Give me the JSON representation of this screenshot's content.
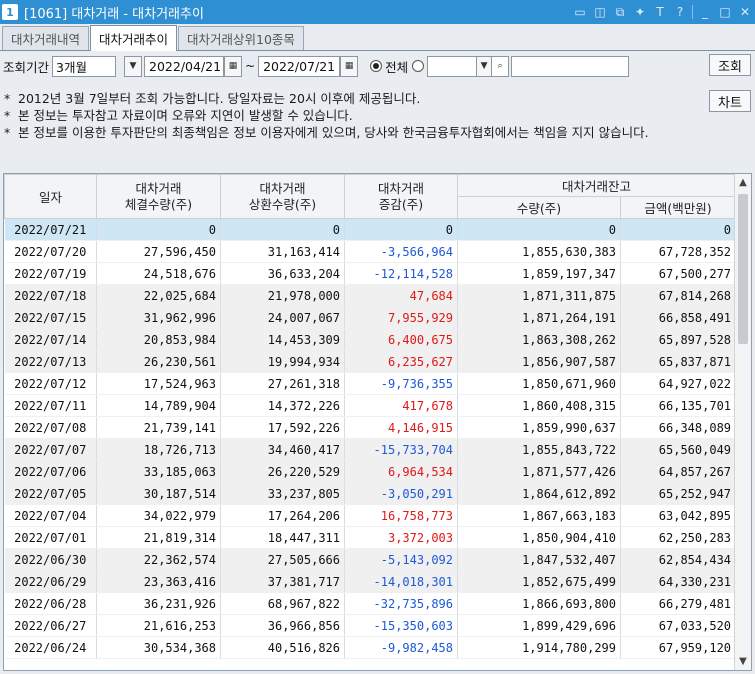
{
  "window": {
    "number": "1",
    "title": "[1061] 대차거래 - 대차거래추이"
  },
  "tabs": [
    {
      "label": "대차거래내역"
    },
    {
      "label": "대차거래추이"
    },
    {
      "label": "대차거래상위10종목"
    }
  ],
  "filter": {
    "period_label": "조회기간",
    "period_value": "3개월",
    "start_date": "2022/04/21",
    "end_date": "2022/07/21",
    "range_sep": "~",
    "radio_all_label": "전체",
    "search_button": "조회",
    "chart_button": "차트"
  },
  "notes": [
    "2012년 3월 7일부터 조회 가능합니다. 당일자료는 20시 이후에 제공됩니다.",
    "본 정보는 투자참고 자료이며 오류와 지연이 발생할 수 있습니다.",
    "본 정보를 이용한 투자판단의 최종책임은 정보 이용자에게 있으며, 당사와 한국금융투자협회에서는 책임을 지지 않습니다."
  ],
  "table": {
    "headers": {
      "date": "일자",
      "executed": "대차거래\n체결수량(주)",
      "repaid": "대차거래\n상환수량(주)",
      "change": "대차거래\n증감(주)",
      "balance_group": "대차거래잔고",
      "balance_qty": "수량(주)",
      "balance_amt": "금액(백만원)"
    },
    "rows": [
      {
        "date": "2022/07/21",
        "executed": "0",
        "repaid": "0",
        "change": "0",
        "qty": "0",
        "amt": "0"
      },
      {
        "date": "2022/07/20",
        "executed": "27,596,450",
        "repaid": "31,163,414",
        "change": "-3,566,964",
        "qty": "1,855,630,383",
        "amt": "67,728,352"
      },
      {
        "date": "2022/07/19",
        "executed": "24,518,676",
        "repaid": "36,633,204",
        "change": "-12,114,528",
        "qty": "1,859,197,347",
        "amt": "67,500,277"
      },
      {
        "date": "2022/07/18",
        "executed": "22,025,684",
        "repaid": "21,978,000",
        "change": "47,684",
        "qty": "1,871,311,875",
        "amt": "67,814,268"
      },
      {
        "date": "2022/07/15",
        "executed": "31,962,996",
        "repaid": "24,007,067",
        "change": "7,955,929",
        "qty": "1,871,264,191",
        "amt": "66,858,491"
      },
      {
        "date": "2022/07/14",
        "executed": "20,853,984",
        "repaid": "14,453,309",
        "change": "6,400,675",
        "qty": "1,863,308,262",
        "amt": "65,897,528"
      },
      {
        "date": "2022/07/13",
        "executed": "26,230,561",
        "repaid": "19,994,934",
        "change": "6,235,627",
        "qty": "1,856,907,587",
        "amt": "65,837,871"
      },
      {
        "date": "2022/07/12",
        "executed": "17,524,963",
        "repaid": "27,261,318",
        "change": "-9,736,355",
        "qty": "1,850,671,960",
        "amt": "64,927,022"
      },
      {
        "date": "2022/07/11",
        "executed": "14,789,904",
        "repaid": "14,372,226",
        "change": "417,678",
        "qty": "1,860,408,315",
        "amt": "66,135,701"
      },
      {
        "date": "2022/07/08",
        "executed": "21,739,141",
        "repaid": "17,592,226",
        "change": "4,146,915",
        "qty": "1,859,990,637",
        "amt": "66,348,089"
      },
      {
        "date": "2022/07/07",
        "executed": "18,726,713",
        "repaid": "34,460,417",
        "change": "-15,733,704",
        "qty": "1,855,843,722",
        "amt": "65,560,049"
      },
      {
        "date": "2022/07/06",
        "executed": "33,185,063",
        "repaid": "26,220,529",
        "change": "6,964,534",
        "qty": "1,871,577,426",
        "amt": "64,857,267"
      },
      {
        "date": "2022/07/05",
        "executed": "30,187,514",
        "repaid": "33,237,805",
        "change": "-3,050,291",
        "qty": "1,864,612,892",
        "amt": "65,252,947"
      },
      {
        "date": "2022/07/04",
        "executed": "34,022,979",
        "repaid": "17,264,206",
        "change": "16,758,773",
        "qty": "1,867,663,183",
        "amt": "63,042,895"
      },
      {
        "date": "2022/07/01",
        "executed": "21,819,314",
        "repaid": "18,447,311",
        "change": "3,372,003",
        "qty": "1,850,904,410",
        "amt": "62,250,283"
      },
      {
        "date": "2022/06/30",
        "executed": "22,362,574",
        "repaid": "27,505,666",
        "change": "-5,143,092",
        "qty": "1,847,532,407",
        "amt": "62,854,434"
      },
      {
        "date": "2022/06/29",
        "executed": "23,363,416",
        "repaid": "37,381,717",
        "change": "-14,018,301",
        "qty": "1,852,675,499",
        "amt": "64,330,231"
      },
      {
        "date": "2022/06/28",
        "executed": "36,231,926",
        "repaid": "68,967,822",
        "change": "-32,735,896",
        "qty": "1,866,693,800",
        "amt": "66,279,481"
      },
      {
        "date": "2022/06/27",
        "executed": "21,616,253",
        "repaid": "36,966,856",
        "change": "-15,350,603",
        "qty": "1,899,429,696",
        "amt": "67,033,520"
      },
      {
        "date": "2022/06/24",
        "executed": "30,534,368",
        "repaid": "40,516,826",
        "change": "-9,982,458",
        "qty": "1,914,780,299",
        "amt": "67,959,120"
      }
    ]
  },
  "colors": {
    "title_bar": "#2f8fd3",
    "negative": "#1f58d8",
    "positive": "#e01818",
    "selected_row": "#cfe7f5"
  }
}
